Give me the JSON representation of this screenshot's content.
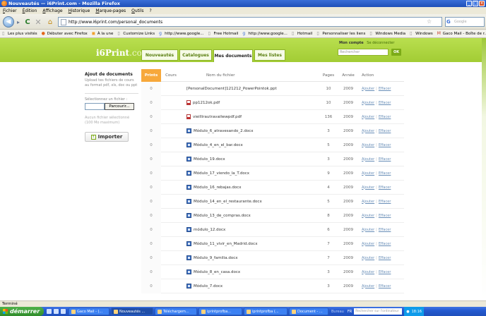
{
  "window": {
    "title": "Nouveautés — i6Print.com - Mozilla Firefox"
  },
  "menu": [
    "Fichier",
    "Édition",
    "Affichage",
    "Historique",
    "Marque-pages",
    "Outils",
    "?"
  ],
  "toolbar": {
    "url": "http://www.i6print.com/personal_documents",
    "search_placeholder": "Google",
    "search_engine": "G"
  },
  "bookmarks": [
    {
      "label": "Les plus visités",
      "icon": "page-icon"
    },
    {
      "label": "Débuter avec Firefox",
      "icon": "firefox-icon"
    },
    {
      "label": "À la une",
      "icon": "rss-icon"
    },
    {
      "label": "Customize Links",
      "icon": "page-icon"
    },
    {
      "label": "http://www.google...",
      "icon": "google-icon"
    },
    {
      "label": "Free Hotmail",
      "icon": "page-icon"
    },
    {
      "label": "http://www.google...",
      "icon": "google-icon"
    },
    {
      "label": "Hotmail",
      "icon": "page-icon"
    },
    {
      "label": "Personnaliser les liens",
      "icon": "page-icon"
    },
    {
      "label": "Windows Media",
      "icon": "page-icon"
    },
    {
      "label": "Windows",
      "icon": "page-icon"
    },
    {
      "label": "Gaco Mail - Boîte de r...",
      "icon": "gmail-icon"
    }
  ],
  "site": {
    "logo_main": "i6Print",
    "logo_suffix": ".com",
    "nav": [
      {
        "label": "Nouveautés",
        "active": false
      },
      {
        "label": "Catalogues",
        "active": false
      },
      {
        "label": "Mes documents",
        "active": true
      },
      {
        "label": "Mes listes",
        "active": false
      }
    ],
    "account_label": "Mon compte",
    "logout_label": "Se déconnecter",
    "search_placeholder": "Rechercher",
    "search_button": "OK"
  },
  "upload": {
    "title": "Ajout de documents",
    "description": "Upload tes fichiers de cours au format pdf, xls, doc ou ppt",
    "select_label": "Sélectionnez un fichier :",
    "browse_label": "Parcourir...",
    "no_file": "Aucun fichier sélectionné (100 Mo maximum)",
    "import_label": "Importer"
  },
  "table": {
    "headers": {
      "prints": "Prints",
      "cours": "Cours",
      "name": "Nom du fichier",
      "pages": "Pages",
      "year": "Année",
      "action": "Action"
    },
    "action_add": "Ajouter",
    "action_delete": "Effacer",
    "rows": [
      {
        "prints": "0",
        "name": "[PersonalDocument]121212_PowerPointok.ppt",
        "type": "ppt",
        "pages": "10",
        "year": "2009"
      },
      {
        "prints": "0",
        "name": "pp1212ok.pdf",
        "type": "pdf",
        "pages": "10",
        "year": "2009"
      },
      {
        "prints": "0",
        "name": "vieillirautravailwwpdf.pdf",
        "type": "pdf",
        "pages": "136",
        "year": "2009"
      },
      {
        "prints": "0",
        "name": "Módulo_6_atravesando_2.docx",
        "type": "doc",
        "pages": "3",
        "year": "2009"
      },
      {
        "prints": "0",
        "name": "Módulo_4_en_el_bar.docx",
        "type": "doc",
        "pages": "5",
        "year": "2009"
      },
      {
        "prints": "0",
        "name": "Módulo_19.docx",
        "type": "doc",
        "pages": "3",
        "year": "2009"
      },
      {
        "prints": "0",
        "name": "Módulo_17_viendo_la_T.docx",
        "type": "doc",
        "pages": "9",
        "year": "2009"
      },
      {
        "prints": "0",
        "name": "Módulo_16_rebajas.docx",
        "type": "doc",
        "pages": "4",
        "year": "2009"
      },
      {
        "prints": "0",
        "name": "Módulo_14_en_el_restaurante.docx",
        "type": "doc",
        "pages": "5",
        "year": "2009"
      },
      {
        "prints": "0",
        "name": "Módulo_13_de_compras.docx",
        "type": "doc",
        "pages": "8",
        "year": "2009"
      },
      {
        "prints": "0",
        "name": "módulo_12.docx",
        "type": "doc",
        "pages": "6",
        "year": "2009"
      },
      {
        "prints": "0",
        "name": "Módulo_11_vivir_en_Madrid.docx",
        "type": "doc",
        "pages": "7",
        "year": "2009"
      },
      {
        "prints": "0",
        "name": "Módulo_9_familia.docx",
        "type": "doc",
        "pages": "7",
        "year": "2009"
      },
      {
        "prints": "0",
        "name": "Módulo_8_en_casa.docx",
        "type": "doc",
        "pages": "3",
        "year": "2009"
      },
      {
        "prints": "0",
        "name": "Módulo_7.docx",
        "type": "doc",
        "pages": "3",
        "year": "2009"
      }
    ]
  },
  "statusbar": {
    "text": "Terminé"
  },
  "taskbar": {
    "start_label": "démarrer",
    "tasks": [
      {
        "label": "Gaco Mail - (...",
        "active": false
      },
      {
        "label": "Nouveautés ...",
        "active": true
      },
      {
        "label": "Téléchargem...",
        "active": false
      },
      {
        "label": "iprintprofba...",
        "active": false
      },
      {
        "label": "iprintprofba (...",
        "active": false
      },
      {
        "label": "Document - ...",
        "active": false
      }
    ],
    "desktop_label": "Bureau",
    "fr_label": "FR",
    "search_placeholder": "Rechercher sur l'ordinateur",
    "clock": "18:16"
  },
  "colors": {
    "site_green": "#a2cc34",
    "accent_orange": "#f7a83b",
    "xp_blue": "#245ad0"
  }
}
